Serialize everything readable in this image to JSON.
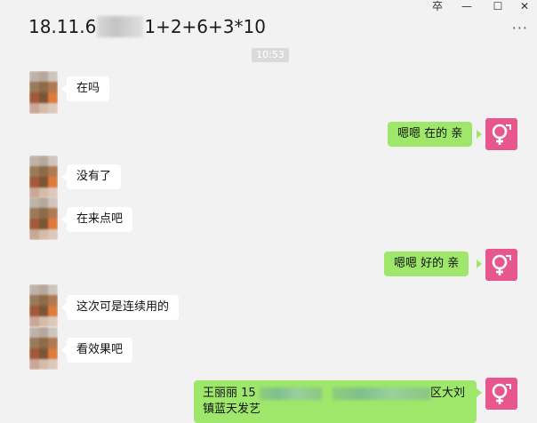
{
  "window": {
    "title_prefix": "18.11.6",
    "title_suffix": "1+2+6+3*10",
    "pin_glyph": "卒",
    "minimize_glyph": "—",
    "maximize_glyph": "☐",
    "close_glyph": "✕",
    "more_glyph": "···"
  },
  "timestamp": "10:53",
  "messages": [
    {
      "side": "left",
      "text": "在吗"
    },
    {
      "side": "right",
      "text": "嗯嗯 在的 亲"
    },
    {
      "side": "left",
      "text": "没有了"
    },
    {
      "side": "left",
      "text": "在来点吧"
    },
    {
      "side": "right",
      "text": "嗯嗯 好的 亲"
    },
    {
      "side": "left",
      "text": "这次可是连续用的"
    },
    {
      "side": "left",
      "text": "看效果吧"
    },
    {
      "side": "right",
      "text_line1_a": "王丽丽  15",
      "text_line1_b": "​​区大刘",
      "text_line2": "镇蓝天发艺"
    }
  ],
  "colors": {
    "bubble_right": "#9ee76b",
    "bubble_left": "#ffffff",
    "avatar_right": "#e8568e",
    "background": "#f2f2f2"
  },
  "icons": {
    "right_avatar": "venus-symbol-icon"
  }
}
